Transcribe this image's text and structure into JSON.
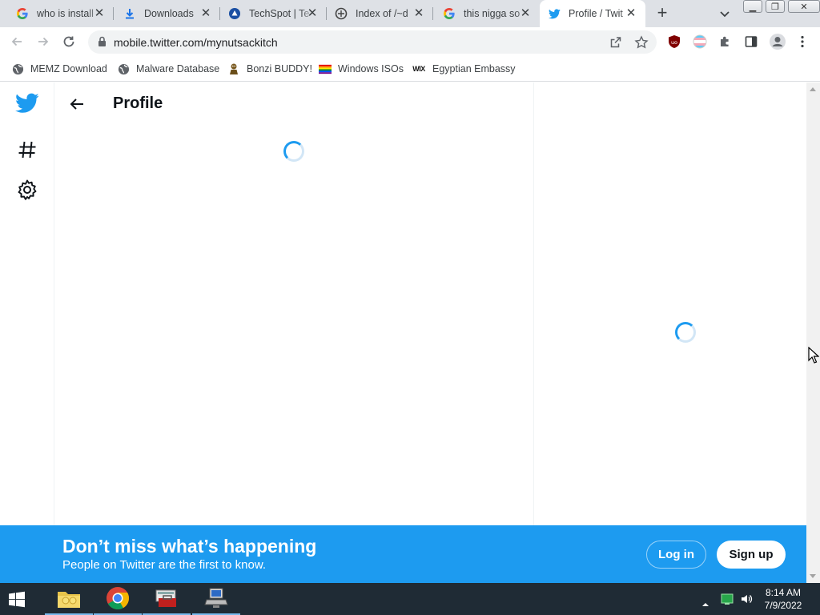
{
  "browser": {
    "tabs": [
      {
        "title": "who is install",
        "icon": "google-g-icon"
      },
      {
        "title": "Downloads",
        "icon": "download-icon"
      },
      {
        "title": "TechSpot | Te",
        "icon": "techspot-icon"
      },
      {
        "title": "Index of /~d",
        "icon": "index-icon"
      },
      {
        "title": "this nigga so",
        "icon": "google-g-icon"
      },
      {
        "title": "Profile / Twit",
        "icon": "twitter-bird-icon",
        "active": true
      }
    ],
    "new_tab": "+",
    "url": "mobile.twitter.com/mynutsackitch",
    "bookmarks": [
      {
        "label": "MEMZ Download",
        "icon": "globe-icon"
      },
      {
        "label": "Malware Database",
        "icon": "globe-icon"
      },
      {
        "label": "Bonzi BUDDY!",
        "icon": "bonzi-icon"
      },
      {
        "label": "Windows ISOs",
        "icon": "rainbow-flag-icon"
      },
      {
        "label": "Egyptian Embassy",
        "icon": "wix-icon"
      }
    ],
    "wix_text": "WIX"
  },
  "twitter": {
    "page_title": "Profile",
    "banner_headline": "Don’t miss what’s happening",
    "banner_sub": "People on Twitter are the first to know.",
    "login_label": "Log in",
    "signup_label": "Sign up",
    "accent_color": "#1d9bf0"
  },
  "taskbar": {
    "time": "8:14 AM",
    "date": "7/9/2022"
  }
}
